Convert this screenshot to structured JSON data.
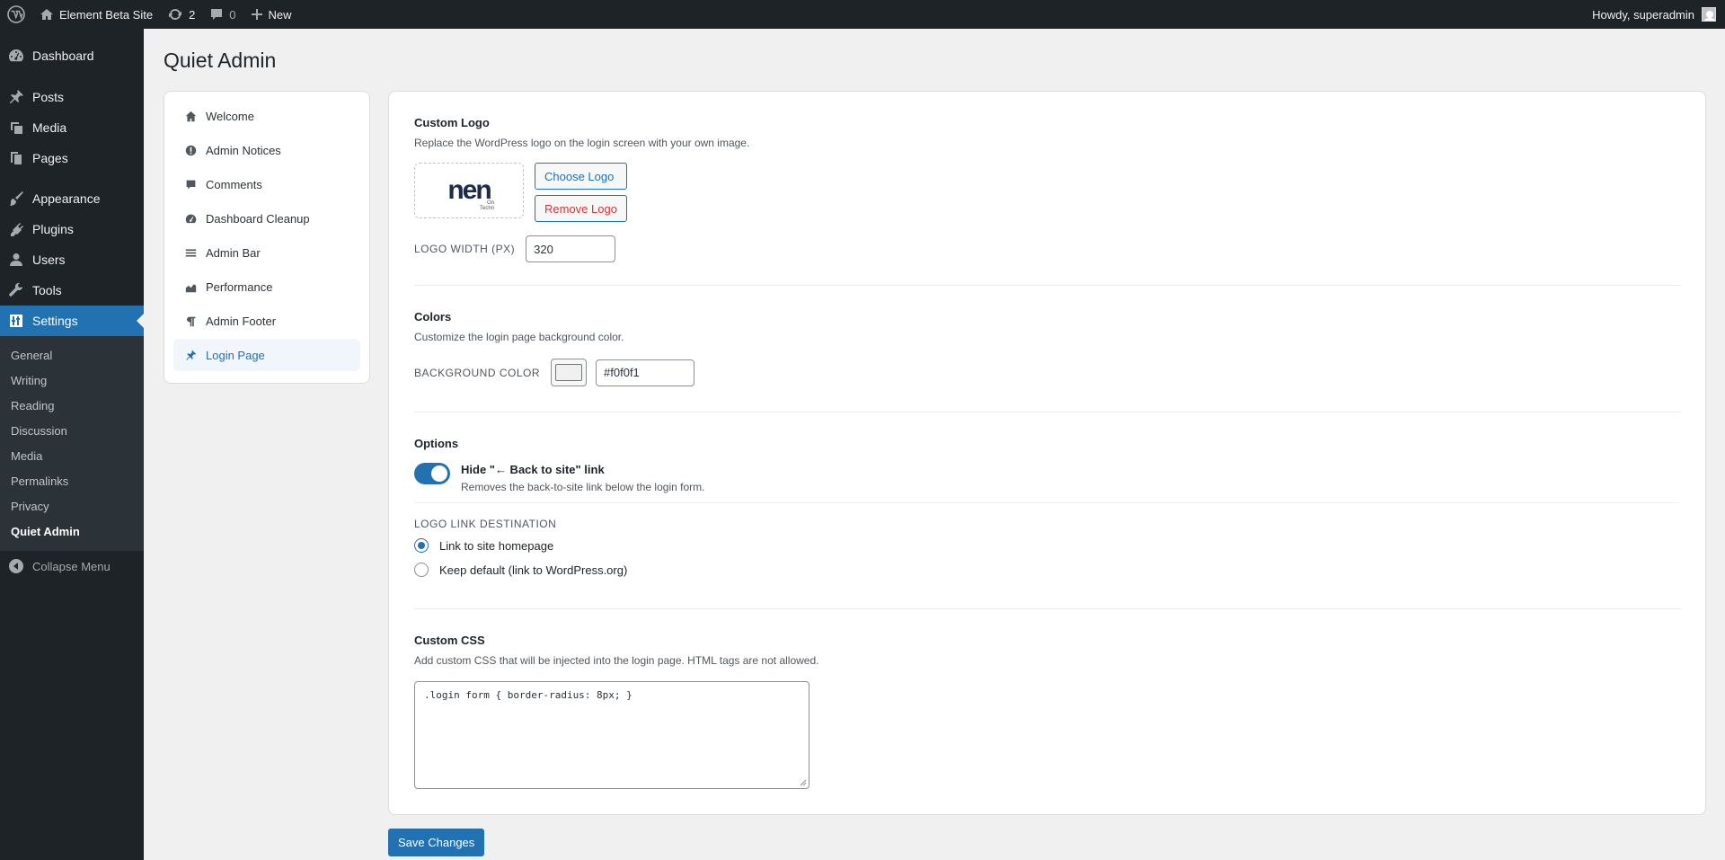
{
  "adminbar": {
    "site_name": "Element Beta Site",
    "updates_count": "2",
    "comments_count": "0",
    "new_label": "New",
    "howdy": "Howdy, superadmin"
  },
  "menu": {
    "items": [
      {
        "label": "Dashboard",
        "icon": "dashboard-icon"
      },
      {
        "label": "Posts",
        "icon": "pin-icon"
      },
      {
        "label": "Media",
        "icon": "media-icon"
      },
      {
        "label": "Pages",
        "icon": "pages-icon"
      },
      {
        "label": "Appearance",
        "icon": "brush-icon"
      },
      {
        "label": "Plugins",
        "icon": "plug-icon"
      },
      {
        "label": "Users",
        "icon": "user-icon"
      },
      {
        "label": "Tools",
        "icon": "wrench-icon"
      },
      {
        "label": "Settings",
        "icon": "settings-icon"
      }
    ],
    "submenu": [
      "General",
      "Writing",
      "Reading",
      "Discussion",
      "Media",
      "Permalinks",
      "Privacy",
      "Quiet Admin"
    ],
    "collapse": "Collapse Menu"
  },
  "page_title": "Quiet Admin",
  "subnav": [
    {
      "label": "Welcome",
      "icon": "home-icon"
    },
    {
      "label": "Admin Notices",
      "icon": "alert-icon"
    },
    {
      "label": "Comments",
      "icon": "comment-icon"
    },
    {
      "label": "Dashboard Cleanup",
      "icon": "gauge-icon"
    },
    {
      "label": "Admin Bar",
      "icon": "menu-lines-icon"
    },
    {
      "label": "Performance",
      "icon": "chart-area-icon"
    },
    {
      "label": "Admin Footer",
      "icon": "paragraph-icon"
    },
    {
      "label": "Login Page",
      "icon": "pin-icon"
    }
  ],
  "logo_section": {
    "title": "Custom Logo",
    "desc": "Replace the WordPress logo on the login screen with your own image.",
    "preview_text": "nen",
    "preview_small_1": "On",
    "preview_small_2": "Techn",
    "choose": "Choose Logo",
    "remove": "Remove Logo",
    "width_label": "LOGO WIDTH (PX)",
    "width_value": "320"
  },
  "colors_section": {
    "title": "Colors",
    "desc": "Customize the login page background color.",
    "bg_label": "BACKGROUND COLOR",
    "bg_value": "#f0f0f1",
    "swatch_color": "#f0f0f1"
  },
  "options_section": {
    "title": "Options",
    "toggle_label": "Hide \"← Back to site\" link",
    "toggle_desc": "Removes the back-to-site link below the login form.",
    "link_dest_label": "LOGO LINK DESTINATION",
    "radio_1": "Link to site homepage",
    "radio_2": "Keep default (link to WordPress.org)"
  },
  "css_section": {
    "title": "Custom CSS",
    "desc": "Add custom CSS that will be injected into the login page. HTML tags are not allowed.",
    "value": ".login form { border-radius: 8px; }"
  },
  "save_label": "Save Changes"
}
